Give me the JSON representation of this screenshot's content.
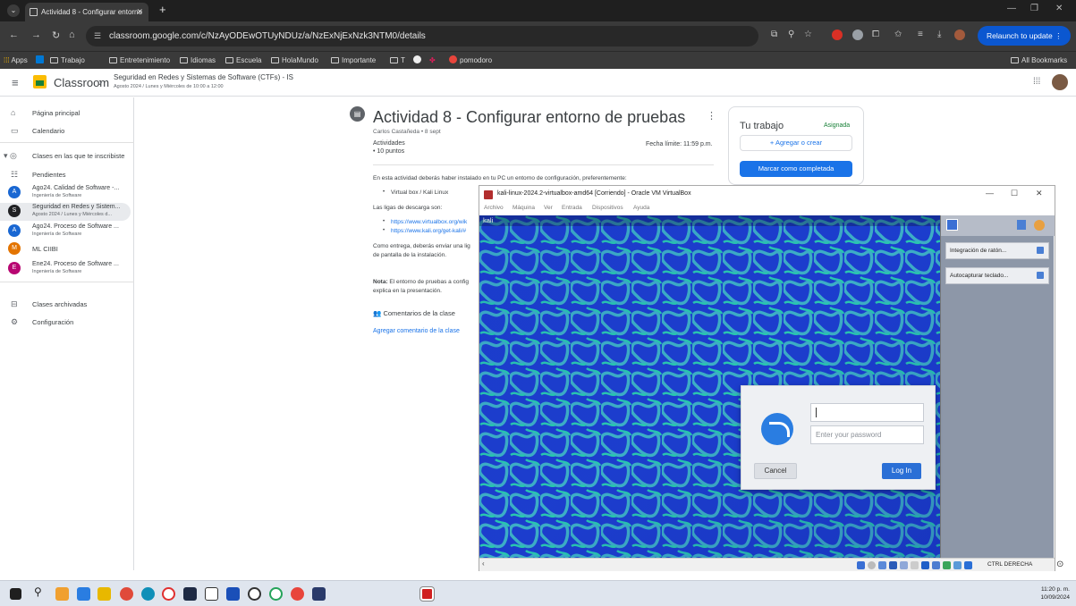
{
  "browser": {
    "tab_title": "Actividad 8 - Configurar entorno",
    "url": "classroom.google.com/c/NzAyODEwOTUyNDUz/a/NzExNjExNzk3NTM0/details",
    "relaunch_label": "Relaunch to update",
    "bookmarks": [
      "Apps",
      "Trabajo",
      "Entretenimiento",
      "Idiomas",
      "Escuela",
      "HolaMundo",
      "Importante",
      "T",
      "pomodoro"
    ],
    "all_bookmarks": "All Bookmarks"
  },
  "classroom": {
    "app_name": "Classroom",
    "class_name": "Seguridad en Redes y Sistemas de Software (CTFs) - IS",
    "class_schedule": "Agosto 2024 / Lunes y Miércoles de 10:00 a 12:00"
  },
  "sidebar": {
    "home": "Página principal",
    "calendar": "Calendario",
    "enrolled": "Clases en las que te inscribiste",
    "pending": "Pendientes",
    "classes": [
      {
        "initial": "A",
        "color": "#1967d2",
        "name": "Ago24. Calidad de Software -...",
        "sub": "Ingeniería de Software"
      },
      {
        "initial": "S",
        "color": "#202124",
        "name": "Seguridad en Redes y Sistem...",
        "sub": "Agosto 2024 / Lunes y Miércoles d..."
      },
      {
        "initial": "A",
        "color": "#1967d2",
        "name": "Ago24. Proceso de Software ...",
        "sub": "Ingeniería de Software"
      },
      {
        "initial": "M",
        "color": "#e37400",
        "name": "ML CIIBI",
        "sub": ""
      },
      {
        "initial": "E",
        "color": "#b80672",
        "name": "Ene24. Proceso de Software ...",
        "sub": "Ingeniería de Software"
      }
    ],
    "archived": "Clases archivadas",
    "settings": "Configuración"
  },
  "assignment": {
    "title": "Actividad 8 - Configurar entorno de pruebas",
    "author": "Carlos Castañeda • 8 sept",
    "label": "Actividades",
    "points": "• 10 puntos",
    "due": "Fecha límite: 11:59 p.m.",
    "intro": "En esta actividad deberás haber instalado en tu PC un entorno de configuración, preferentemente:",
    "item": "Virtual box / Kali Linux",
    "links_label": "Las ligas de descarga son:",
    "link1": "https://www.virtualbox.org/wik",
    "link2": "https://www.kali.org/get-kali/#",
    "deliver1": "Como entrega, deberás enviar una lig",
    "deliver2": "de pantalla de la instalación.",
    "note_bold": "Nota:",
    "note1": " El entorno de pruebas a config",
    "note2": "explica en la presentación.",
    "comments_title": "Comentarios de la clase",
    "add_comment": "Agregar comentario de la clase"
  },
  "your_work": {
    "title": "Tu trabajo",
    "status": "Asignada",
    "add_button": "+  Agregar o crear",
    "mark_button": "Marcar como completada"
  },
  "virtualbox": {
    "window_title": "kali-linux-2024.2-virtualbox-amd64 [Corriendo] - Oracle VM VirtualBox",
    "menu": [
      "Archivo",
      "Máquina",
      "Ver",
      "Entrada",
      "Dispositivos",
      "Ayuda"
    ],
    "guest_title": "kali",
    "panel_items": [
      "Integración de ratón...",
      "Autocapturar teclado..."
    ],
    "host_key": "CTRL DERECHA"
  },
  "kali_login": {
    "username_value": "",
    "password_placeholder": "Enter your password",
    "cancel": "Cancel",
    "login": "Log In"
  },
  "taskbar": {
    "time": "11:20 p. m.",
    "date": "10/09/2024"
  }
}
